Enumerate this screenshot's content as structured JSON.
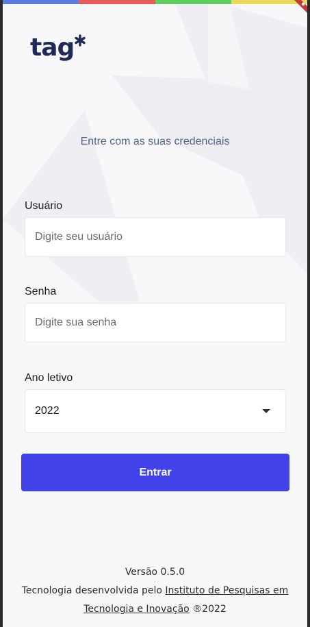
{
  "colors": {
    "bar_blue": "#5b7be0",
    "bar_red": "#e85a5a",
    "bar_green": "#5ecf5e",
    "bar_yellow": "#e8d95a",
    "ribbon": "#c83a3a",
    "accent": "#4143e8",
    "logo": "#1e2a55"
  },
  "logo": {
    "text": "tag",
    "star_icon": "asterisk-icon"
  },
  "subtitle": "Entre com as suas credenciais",
  "form": {
    "username": {
      "label": "Usuário",
      "placeholder": "Digite seu usuário",
      "value": ""
    },
    "password": {
      "label": "Senha",
      "placeholder": "Digite sua senha",
      "value": ""
    },
    "school_year": {
      "label": "Ano letivo",
      "value": "2022",
      "icon": "chevron-down-icon"
    },
    "submit_label": "Entrar"
  },
  "footer": {
    "version": "Versão 0.5.0",
    "prefix": "Tecnologia desenvolvida pelo ",
    "institute_link": "Instituto de Pesquisas em Tecnologia e Inovação",
    "suffix": " ®2022"
  }
}
